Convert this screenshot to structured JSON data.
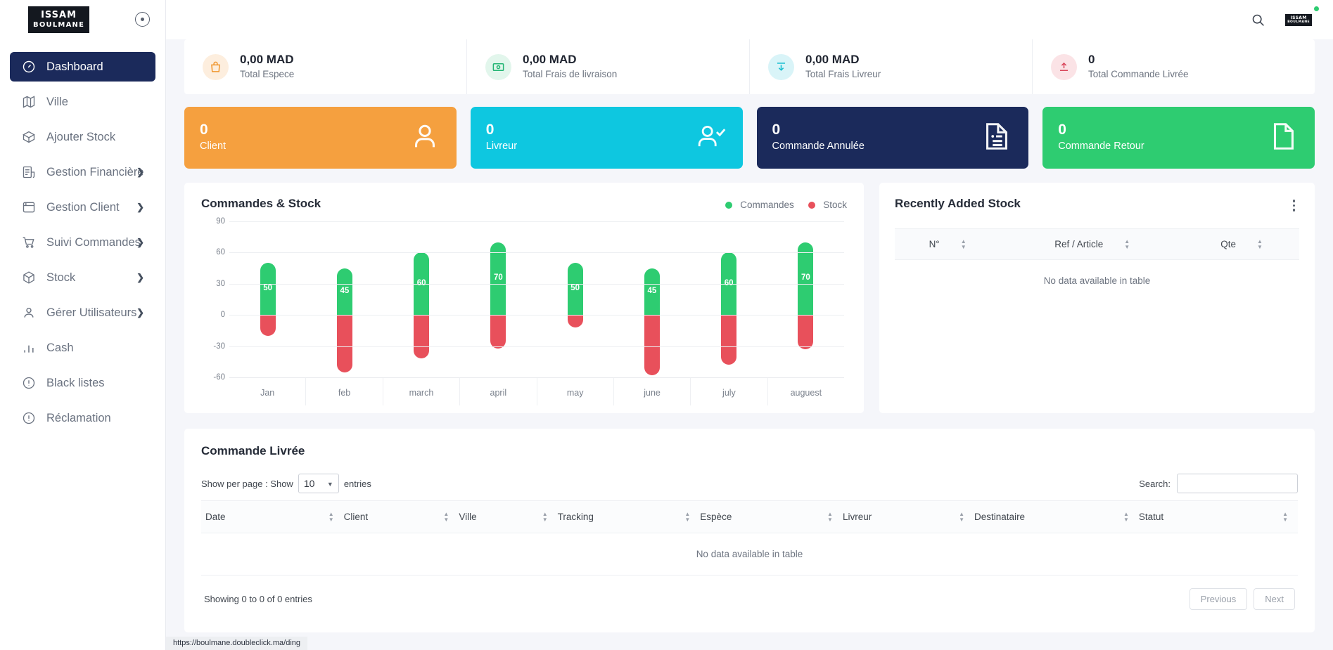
{
  "brand": {
    "line1": "ISSAM",
    "line2": "BOULMANE"
  },
  "sidebar": {
    "items": [
      {
        "label": "Dashboard",
        "icon": "gauge-icon",
        "active": true,
        "caret": false
      },
      {
        "label": "Ville",
        "icon": "map-icon",
        "active": false,
        "caret": false
      },
      {
        "label": "Ajouter Stock",
        "icon": "box-icon",
        "active": false,
        "caret": false
      },
      {
        "label": "Gestion Financière",
        "icon": "invoice-icon",
        "active": false,
        "caret": true
      },
      {
        "label": "Gestion Client",
        "icon": "wallet-icon",
        "active": false,
        "caret": true
      },
      {
        "label": "Suivi Commandes",
        "icon": "cart-icon",
        "active": false,
        "caret": true
      },
      {
        "label": "Stock",
        "icon": "cube-icon",
        "active": false,
        "caret": true
      },
      {
        "label": "Gérer Utilisateurs",
        "icon": "user-icon",
        "active": false,
        "caret": true
      },
      {
        "label": "Cash",
        "icon": "bar-chart-icon",
        "active": false,
        "caret": false
      },
      {
        "label": "Black listes",
        "icon": "alert-icon",
        "active": false,
        "caret": false
      },
      {
        "label": "Réclamation",
        "icon": "alert-icon",
        "active": false,
        "caret": false
      }
    ]
  },
  "topbar": {
    "search_icon": "search-icon",
    "avatar_icon": "avatar",
    "status": "online"
  },
  "stats": [
    {
      "value": "0,00 MAD",
      "label": "Total Espece",
      "icon": "bag-icon",
      "color": "#f0962e",
      "bg": "#fdeede"
    },
    {
      "value": "0,00 MAD",
      "label": "Total Frais de livraison",
      "icon": "money-icon",
      "color": "#22b573",
      "bg": "#e2f6ec"
    },
    {
      "value": "0,00 MAD",
      "label": "Total Frais Livreur",
      "icon": "download-icon",
      "color": "#17bed0",
      "bg": "#d9f4f8"
    },
    {
      "value": "0",
      "label": "Total Commande Livrée",
      "icon": "upload-icon",
      "color": "#d9455a",
      "bg": "#fbe3e6"
    }
  ],
  "tiles": [
    {
      "value": "0",
      "label": "Client",
      "icon": "person-icon",
      "bg": "#f5a03f"
    },
    {
      "value": "0",
      "label": "Livreur",
      "icon": "person-check-icon",
      "bg": "#0ec7e0"
    },
    {
      "value": "0",
      "label": "Commande Annulée",
      "icon": "document-lines-icon",
      "bg": "#1b2a5b"
    },
    {
      "value": "0",
      "label": "Commande Retour",
      "icon": "document-icon",
      "bg": "#2ecc71"
    }
  ],
  "chart_panel": {
    "title": "Commandes & Stock",
    "legend": [
      {
        "label": "Commandes",
        "color": "#2ecc71"
      },
      {
        "label": "Stock",
        "color": "#e8505b"
      }
    ]
  },
  "chart_data": {
    "type": "bar",
    "title": "Commandes & Stock",
    "xlabel": "",
    "ylabel": "",
    "ylim": [
      -60,
      90
    ],
    "yticks": [
      90,
      60,
      30,
      0,
      -30,
      -60
    ],
    "grid": true,
    "legend_position": "top-right",
    "stacked_diverging": true,
    "categories": [
      "Jan",
      "feb",
      "march",
      "april",
      "may",
      "june",
      "july",
      "auguest"
    ],
    "series": [
      {
        "name": "Commandes",
        "color": "#2ecc71",
        "values": [
          50,
          45,
          60,
          70,
          50,
          45,
          60,
          70
        ],
        "data_labels": [
          "50",
          "45",
          "60",
          "70",
          "50",
          "45",
          "60",
          "70"
        ]
      },
      {
        "name": "Stock",
        "color": "#e8505b",
        "values": [
          -20,
          -55,
          -42,
          -32,
          -12,
          -58,
          -48,
          -33
        ],
        "data_labels": [
          "",
          "",
          "",
          "",
          "",
          "",
          "",
          ""
        ]
      }
    ]
  },
  "stock_panel": {
    "title": "Recently Added Stock",
    "menu_icon": "kebab-menu-icon",
    "columns": [
      "N°",
      "Ref / Article",
      "Qte"
    ],
    "empty_text": "No data available in table"
  },
  "delivered_panel": {
    "title": "Commande Livrée",
    "show_prefix": "Show per page : Show",
    "show_value": "10",
    "show_suffix": "entries",
    "search_label": "Search:",
    "search_value": "",
    "search_placeholder": "",
    "columns": [
      "Date",
      "Client",
      "Ville",
      "Tracking",
      "Espèce",
      "Livreur",
      "Destinataire",
      "Statut"
    ],
    "empty_text": "No data available in table",
    "info": "Showing 0 to 0 of 0 entries",
    "prev_label": "Previous",
    "next_label": "Next"
  },
  "statusbar": {
    "text": "https://boulmane.doubleclick.ma/ding"
  }
}
